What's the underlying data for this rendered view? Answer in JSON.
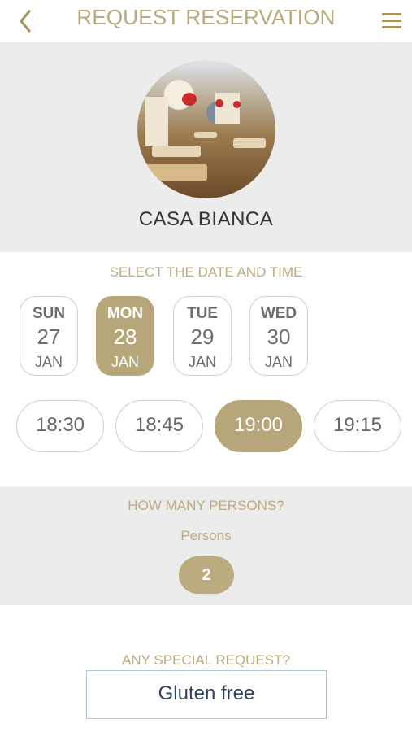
{
  "header": {
    "title": "REQUEST RESERVATION",
    "back_icon": "chevron-left-icon",
    "menu_icon": "hamburger-menu-icon",
    "accent_color": "#b9a97c"
  },
  "restaurant": {
    "name": "CASA BIANCA"
  },
  "date_time": {
    "label": "SELECT THE DATE AND TIME",
    "dates": [
      {
        "dow": "SUN",
        "day": "27",
        "month": "JAN",
        "selected": false
      },
      {
        "dow": "MON",
        "day": "28",
        "month": "JAN",
        "selected": true
      },
      {
        "dow": "TUE",
        "day": "29",
        "month": "JAN",
        "selected": false
      },
      {
        "dow": "WED",
        "day": "30",
        "month": "JAN",
        "selected": false
      }
    ],
    "times": [
      {
        "label": "18:30",
        "selected": false
      },
      {
        "label": "18:45",
        "selected": false
      },
      {
        "label": "19:00",
        "selected": true
      },
      {
        "label": "19:15",
        "selected": false
      }
    ]
  },
  "persons": {
    "label": "HOW MANY PERSONS?",
    "sublabel": "Persons",
    "count": "2"
  },
  "special_request": {
    "label": "ANY SPECIAL REQUEST?",
    "value": "Gluten free"
  },
  "colors": {
    "accent": "#b7a679",
    "section_bg": "#ececec",
    "input_border": "#a9c7dc"
  }
}
